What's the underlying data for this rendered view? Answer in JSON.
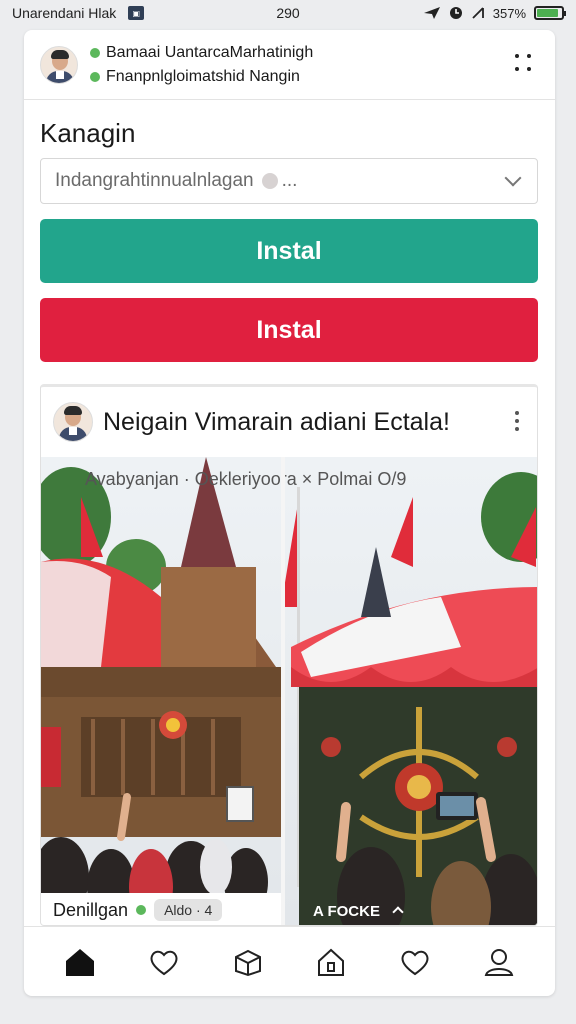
{
  "status_bar": {
    "left_text": "Unarеndani Hlak",
    "time": "290",
    "battery": "357%",
    "battery_level": 0.8
  },
  "header": {
    "line1": "Bamaai UantarcaΜarhatinigh",
    "line2": "Fnanpnlgloimatshid Nangin"
  },
  "section": {
    "title": "Kanagin",
    "dropdown_value": "Indangrahtinnualnlagan",
    "dropdown_suffix": "..."
  },
  "buttons": {
    "primary_label": "Instal",
    "secondary_label": "Instal"
  },
  "post": {
    "title": "Neigain Vimarain adiani Ectala!",
    "caption": "Avabyanjan · Oekleriyoora × Polmai O/9",
    "footer_left": "Denillgan",
    "footer_pill": "Aldo · 4",
    "footer_right": "A FOCKE"
  },
  "nav": {
    "items": [
      "home-icon",
      "heart-chat-icon",
      "cube-icon",
      "home-alt-icon",
      "heart-icon",
      "profile-icon"
    ]
  },
  "colors": {
    "primary": "#22a58c",
    "secondary": "#e0203f"
  }
}
